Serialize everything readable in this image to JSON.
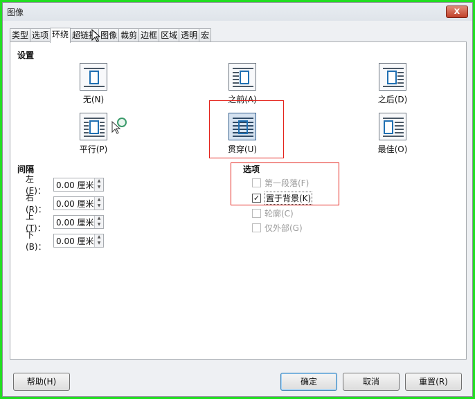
{
  "window": {
    "title": "图像",
    "close_label": "x"
  },
  "tabs": [
    {
      "label": "类型"
    },
    {
      "label": "选项"
    },
    {
      "label": "环绕"
    },
    {
      "label": "超链接"
    },
    {
      "label": "图像"
    },
    {
      "label": "裁剪"
    },
    {
      "label": "边框"
    },
    {
      "label": "区域"
    },
    {
      "label": "透明"
    },
    {
      "label": "宏"
    }
  ],
  "settings": {
    "heading": "设置",
    "options": [
      {
        "label": "无(N)",
        "icon": "wrap-none-icon"
      },
      {
        "label": "之前(A)",
        "icon": "wrap-before-icon"
      },
      {
        "label": "之后(D)",
        "icon": "wrap-after-icon"
      },
      {
        "label": "平行(P)",
        "icon": "wrap-parallel-icon"
      },
      {
        "label": "贯穿(U)",
        "icon": "wrap-through-icon",
        "selected": true
      },
      {
        "label": "最佳(O)",
        "icon": "wrap-optimal-icon"
      }
    ]
  },
  "spacing": {
    "heading": "间隔",
    "rows": [
      {
        "label": "左(E)：",
        "value": "0.00 厘米"
      },
      {
        "label": "右(R)：",
        "value": "0.00 厘米"
      },
      {
        "label": "上(T)：",
        "value": "0.00 厘米"
      },
      {
        "label": "下(B)：",
        "value": "0.00 厘米"
      }
    ]
  },
  "options": {
    "heading": "选项",
    "items": [
      {
        "label": "第一段落(F)",
        "checked": false,
        "enabled": false
      },
      {
        "label": "置于背景(K)",
        "checked": true,
        "enabled": true
      },
      {
        "label": "轮廓(C)",
        "checked": false,
        "enabled": false
      },
      {
        "label": "仅外部(G)",
        "checked": false,
        "enabled": false
      }
    ]
  },
  "buttons": {
    "help": "帮助(H)",
    "ok": "确定",
    "cancel": "取消",
    "reset": "重置(R)"
  },
  "colors": {
    "annotation": "#e4221b",
    "selected_fill": "#d5e2f0",
    "frame": "#22dd22"
  }
}
